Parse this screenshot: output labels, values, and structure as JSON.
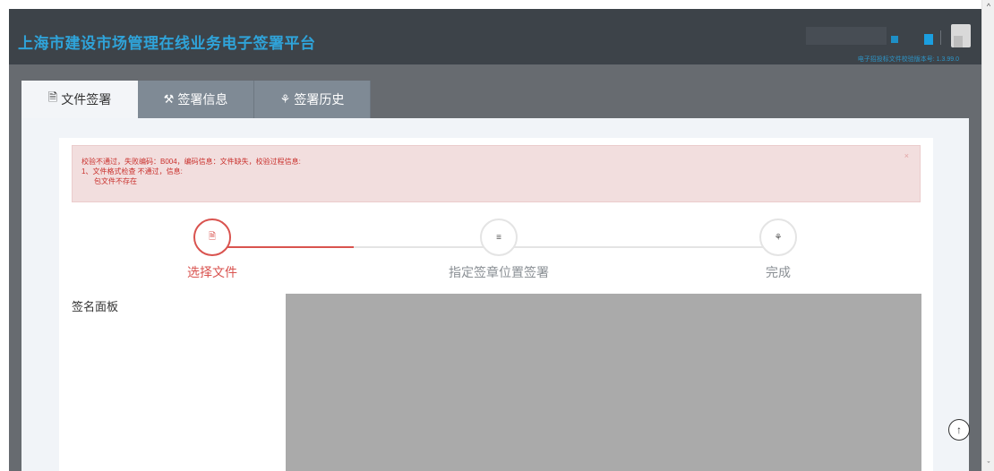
{
  "header": {
    "title": "上海市建设市场管理在线业务电子签署平台",
    "version": "电子招投标文件校验版本号: 1.3.99.0"
  },
  "tabs": [
    {
      "label": "文件签署",
      "icon": "file-text-icon",
      "active": true
    },
    {
      "label": "签署信息",
      "icon": "gavel-icon",
      "active": false
    },
    {
      "label": "签署历史",
      "icon": "seal-icon",
      "active": false
    }
  ],
  "alert": {
    "line1": "校验不通过，失败编码：B004，编码信息：文件缺失，校验过程信息:",
    "line2": "1、文件格式检查 不通过，信息:",
    "line3": "包文件不存在",
    "close": "×",
    "color": "#c9302c"
  },
  "steps": [
    {
      "label": "选择文件",
      "icon": "file-icon",
      "state": "active"
    },
    {
      "label": "指定签章位置签署",
      "icon": "list-icon",
      "state": "pending"
    },
    {
      "label": "完成",
      "icon": "seal-icon",
      "state": "pending"
    }
  ],
  "progress_fraction": 0.5,
  "signature": {
    "label": "签名面板"
  },
  "colors": {
    "header_bg": "#3d4349",
    "title": "#2fa3d9",
    "accent_red": "#d9534f",
    "alert_bg": "#f2dede",
    "canvas_bg": "#aaaaaa"
  }
}
